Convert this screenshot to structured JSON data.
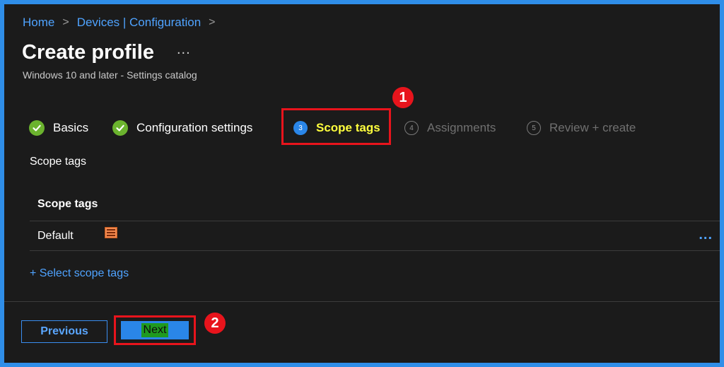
{
  "breadcrumb": {
    "home": "Home",
    "sep": ">",
    "devices": "Devices | Configuration"
  },
  "header": {
    "title": "Create profile",
    "more": "...",
    "subtitle": "Windows 10 and later - Settings catalog"
  },
  "wizard": {
    "steps": [
      {
        "label": "Basics",
        "state": "completed"
      },
      {
        "label": "Configuration settings",
        "state": "completed"
      },
      {
        "number": "3",
        "label": "Scope tags",
        "state": "active"
      },
      {
        "number": "4",
        "label": "Assignments",
        "state": "disabled"
      },
      {
        "number": "5",
        "label": "Review + create",
        "state": "disabled"
      }
    ]
  },
  "annotations": {
    "badge1": "1",
    "badge2": "2"
  },
  "scope": {
    "section_label": "Scope tags",
    "table_header": "Scope tags",
    "rows": [
      {
        "value": "Default",
        "more": "..."
      }
    ],
    "select_link": "+ Select scope tags"
  },
  "footer": {
    "previous_label": "Previous",
    "next_label": "Next"
  },
  "colors": {
    "accent": "#2a86e8",
    "link": "#4fa3ff",
    "highlight": "#e8141c",
    "success": "#6bb32e",
    "active_label": "#ffff3d"
  }
}
